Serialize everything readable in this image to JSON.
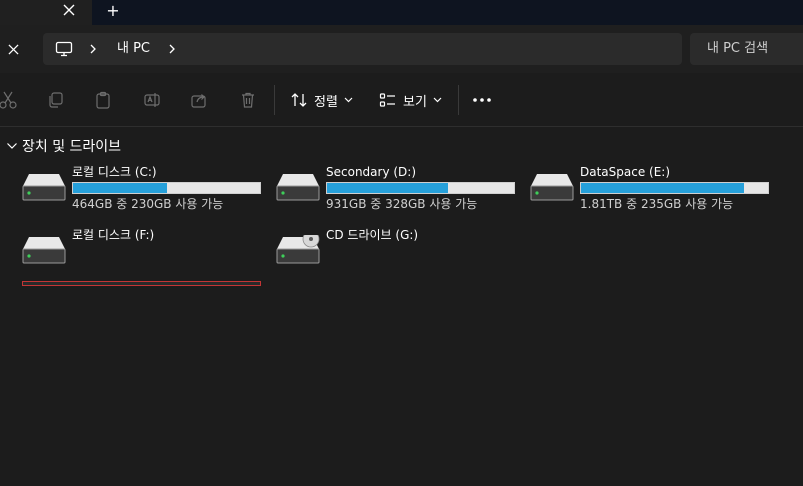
{
  "tabs": {
    "new_tab": "+"
  },
  "address": {
    "crumb": "내 PC",
    "search_placeholder": "내 PC 검색"
  },
  "toolbar": {
    "sort_label": "정렬",
    "view_label": "보기"
  },
  "section": {
    "title": "장치 및 드라이브"
  },
  "drives": [
    {
      "name": "로컬 디스크 (C:)",
      "space": "464GB 중 230GB 사용 가능",
      "used_fraction": 0.504
    },
    {
      "name": "Secondary (D:)",
      "space": "931GB 중 328GB 사용 가능",
      "used_fraction": 0.648
    },
    {
      "name": "DataSpace (E:)",
      "space": "1.81TB 중 235GB 사용 가능",
      "used_fraction": 0.873
    },
    {
      "name": "로컬 디스크 (F:)"
    },
    {
      "name": "CD 드라이브 (G:)"
    }
  ],
  "colors": {
    "background": "#1c1c1c",
    "bar_fill": "#26a0da",
    "bar_track": "#e6e6e6",
    "highlight": "#c33535"
  }
}
